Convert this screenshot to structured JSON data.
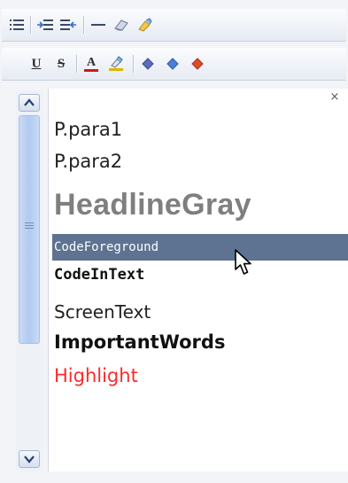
{
  "toolbar_row1": {
    "buttons": [
      {
        "name": "list-icon",
        "glyph": "☰"
      },
      {
        "name": "indent-icon",
        "glyph": "⇥"
      },
      {
        "name": "outdent-icon",
        "glyph": "⇤"
      },
      {
        "name": "horizontal-rule-icon",
        "glyph": "—"
      },
      {
        "name": "eraser-icon",
        "glyph": "⌫"
      },
      {
        "name": "clean-format-icon",
        "glyph": "✎"
      }
    ]
  },
  "toolbar_row2": {
    "underline_label": "U",
    "strikethrough_label": "S",
    "font_color_label": "A",
    "accent_colors": {
      "font_color_bar": "#d01818",
      "highlight_bar": "#e0b400",
      "diamond1": "#5a6dbf",
      "diamond2": "#4b7fd9",
      "diamond3": "#e04a2a"
    }
  },
  "scrollbar": {
    "up": "▲",
    "down": "▼"
  },
  "close_label": "×",
  "styles_list": {
    "items": [
      {
        "label": "P.para1"
      },
      {
        "label": "P.para2"
      },
      {
        "label": "HeadlineGray"
      },
      {
        "label": "CodeForeground",
        "selected": true
      },
      {
        "label": "CodeInText"
      },
      {
        "label": "ScreenText"
      },
      {
        "label": "ImportantWords"
      },
      {
        "label": "Highlight",
        "color": "#ff2a2a"
      }
    ]
  }
}
